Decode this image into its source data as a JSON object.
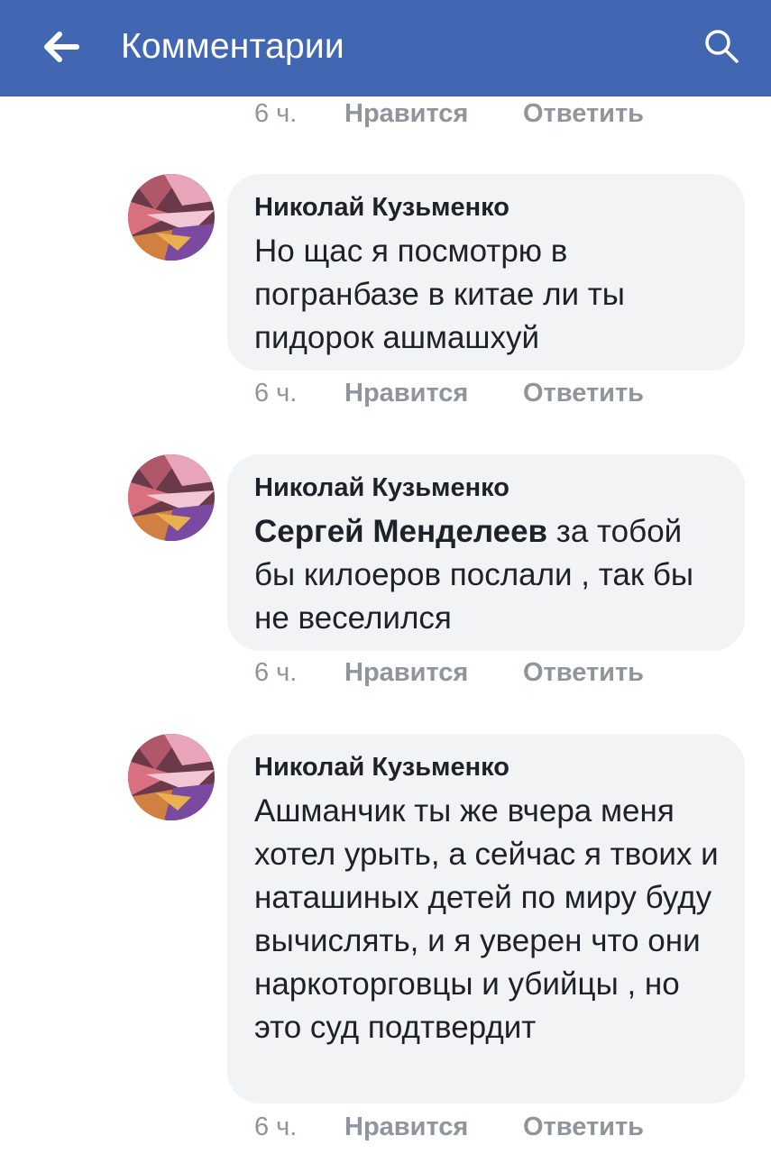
{
  "header": {
    "title": "Комментарии",
    "background": "#4267b2",
    "back_icon": "arrow-left-icon",
    "search_icon": "search-icon"
  },
  "actions_labels": {
    "time": "6 ч.",
    "like": "Нравится",
    "reply": "Ответить"
  },
  "comments": [
    {
      "author": "Николай Кузьменко",
      "text": "Но щас я посмотрю в погранбазе в китае ли ты пидорок ашмашхуй"
    },
    {
      "author": "Николай Кузьменко",
      "mention": "Сергей Менделеев",
      "text": " за тобой бы килоеров послали , так бы не веселился"
    },
    {
      "author": "Николай Кузьменко",
      "text": "Ашманчик ты же вчера меня хотел урыть, а сейчас я твоих и наташиных детей по миру буду вычислять, и я уверен что они наркоторговцы и убийцы , но это суд подтвердит"
    }
  ],
  "colors": {
    "bubble": "#f2f3f5",
    "meta_text": "#90949c",
    "body_text": "#1d2129"
  }
}
